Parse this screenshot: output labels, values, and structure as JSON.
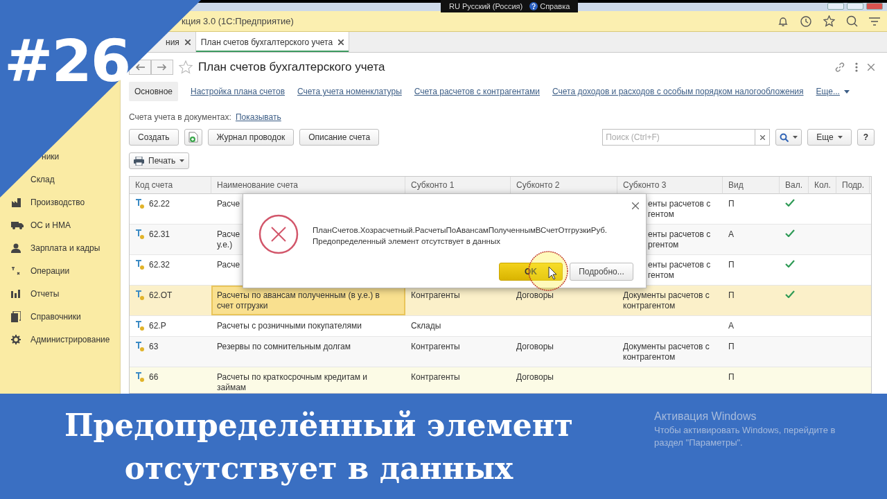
{
  "top_bar": {
    "language": "RU Русский (Россия)",
    "help": "Справка"
  },
  "app_title": "кция 3.0  (1С:Предприятие)",
  "tabs": [
    {
      "label": "ния",
      "selected": false
    },
    {
      "label": "План счетов бухгалтерского учета",
      "selected": true
    }
  ],
  "sidebar": {
    "items": [
      {
        "label": "ники"
      },
      {
        "label": "Склад"
      },
      {
        "label": "Производство"
      },
      {
        "label": "ОС и НМА"
      },
      {
        "label": "Зарплата и кадры"
      },
      {
        "label": "Операции"
      },
      {
        "label": "Отчеты"
      },
      {
        "label": "Справочники"
      },
      {
        "label": "Администрирование"
      }
    ]
  },
  "form": {
    "title": "План счетов бухгалтерского учета",
    "nav_tabs": [
      {
        "label": "Основное",
        "selected": true
      },
      {
        "label": "Настройка плана счетов",
        "selected": false
      },
      {
        "label": "Счета учета номенклатуры",
        "selected": false
      },
      {
        "label": "Счета расчетов с контрагентами",
        "selected": false
      },
      {
        "label": "Счета доходов и расходов с особым порядком налогообложения",
        "selected": false
      },
      {
        "label": "Еще...",
        "selected": false
      }
    ],
    "documents_label": "Счета учета в документах:",
    "documents_link": "Показывать",
    "buttons": [
      "Создать",
      "Журнал проводок",
      "Описание счета"
    ],
    "search": {
      "placeholder": "Поиск (Ctrl+F)"
    },
    "more_button": "Еще",
    "help_button": "?",
    "print_button": "Печать"
  },
  "table": {
    "columns": [
      "Код счета",
      "Наименование счета",
      "Субконто 1",
      "Субконто 2",
      "Субконто 3",
      "Вид",
      "Вал.",
      "Кол.",
      "Подр."
    ],
    "rows": [
      {
        "code": "62.22",
        "name": "Расче",
        "sub3": "енты расчетов с\nгентом",
        "account_type": "П",
        "currency": true,
        "selected": false
      },
      {
        "code": "62.31",
        "name": "Расче\nу.е.)",
        "sub3": "енты расчетов с\nргентом",
        "account_type": "А",
        "currency": true,
        "selected": false
      },
      {
        "code": "62.32",
        "name": "Расче",
        "sub3": "енты расчетов с\nгентом",
        "account_type": "П",
        "currency": true,
        "selected": false
      },
      {
        "code": "62.ОТ",
        "name": "Расчеты по авансам полученным (в у.е.) в счет отгрузки",
        "sub1": "Контрагенты",
        "sub2": "Договоры",
        "sub3": "Документы расчетов с контрагентом",
        "account_type": "П",
        "currency": true,
        "selected": true
      },
      {
        "code": "62.Р",
        "name": "Расчеты с розничными покупателями",
        "sub1": "Склады",
        "account_type": "А",
        "currency": false,
        "selected": false
      },
      {
        "code": "63",
        "name": "Резервы по сомнительным долгам",
        "sub1": "Контрагенты",
        "sub2": "Договоры",
        "sub3": "Документы расчетов с контрагентом",
        "account_type": "П",
        "currency": false,
        "selected": false
      },
      {
        "code": "66",
        "name": "Расчеты по краткосрочным кредитам и займам",
        "sub1": "Контрагенты",
        "sub2": "Договоры",
        "account_type": "П",
        "currency": false,
        "selected": false
      }
    ]
  },
  "dialog": {
    "message": "ПланСчетов.Хозрасчетный.РасчетыПоАвансамПолученнымВСчетОтгрузкиРуб.\nПредопределенный элемент отсутствует в данных",
    "buttons": [
      {
        "label": "OK",
        "selected": true
      },
      {
        "label": "Подробно...",
        "selected": false
      }
    ]
  },
  "banner": {
    "episode": "#26",
    "caption": "Предопределённый элемент\nотсутствует в данных"
  },
  "windows_activation": {
    "title": "Активация Windows",
    "text": "Чтобы активировать Windows, перейдите в\nраздел \"Параметры\"."
  }
}
